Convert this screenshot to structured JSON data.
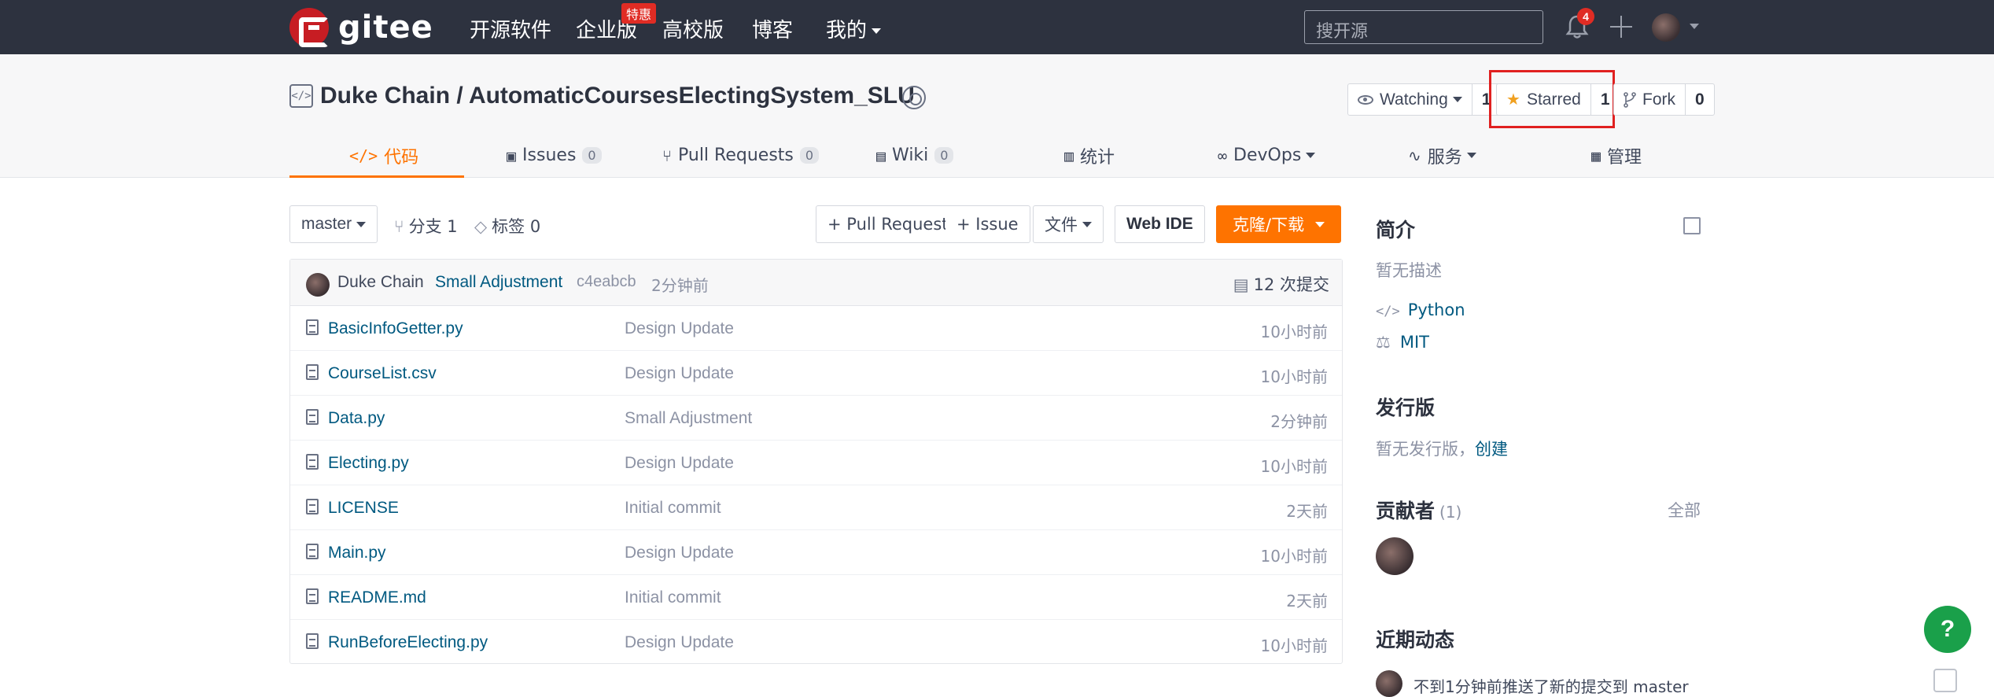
{
  "brand": {
    "name": "gitee"
  },
  "nav": {
    "items": [
      {
        "label": "开源软件"
      },
      {
        "label": "企业版"
      },
      {
        "label": "高校版"
      },
      {
        "label": "博客"
      },
      {
        "label": "我的"
      }
    ],
    "enterprise_badge": "特惠",
    "search_placeholder": "搜开源",
    "notification_count": "4"
  },
  "repo": {
    "owner": "Duke Chain",
    "separator": " / ",
    "name": "AutomaticCoursesElectingSystem_SLU",
    "watch": {
      "label": "Watching",
      "count": "1"
    },
    "star": {
      "label": "Starred",
      "count": "1"
    },
    "fork": {
      "label": "Fork",
      "count": "0"
    }
  },
  "tabs": [
    {
      "label": "代码",
      "active": true
    },
    {
      "label": "Issues",
      "count": "0"
    },
    {
      "label": "Pull Requests",
      "count": "0"
    },
    {
      "label": "Wiki",
      "count": "0"
    },
    {
      "label": "统计"
    },
    {
      "label": "DevOps"
    },
    {
      "label": "服务"
    },
    {
      "label": "管理"
    }
  ],
  "toolbar": {
    "branch": "master",
    "branches_label": "分支 1",
    "tags_label": "标签 0",
    "pull_request": "+ Pull Request",
    "issue": "+ Issue",
    "file": "文件",
    "web_ide": "Web IDE",
    "clone": "克隆/下载"
  },
  "latest_commit": {
    "author": "Duke Chain",
    "message": "Small Adjustment",
    "hash": "c4eabcb",
    "time": "2分钟前",
    "commit_count": "12 次提交"
  },
  "files": [
    {
      "name": "BasicInfoGetter.py",
      "message": "Design Update",
      "time": "10小时前"
    },
    {
      "name": "CourseList.csv",
      "message": "Design Update",
      "time": "10小时前"
    },
    {
      "name": "Data.py",
      "message": "Small Adjustment",
      "time": "2分钟前"
    },
    {
      "name": "Electing.py",
      "message": "Design Update",
      "time": "10小时前"
    },
    {
      "name": "LICENSE",
      "message": "Initial commit",
      "time": "2天前"
    },
    {
      "name": "Main.py",
      "message": "Design Update",
      "time": "10小时前"
    },
    {
      "name": "README.md",
      "message": "Initial commit",
      "time": "2天前"
    },
    {
      "name": "RunBeforeElecting.py",
      "message": "Design Update",
      "time": "10小时前"
    }
  ],
  "sidebar": {
    "intro_title": "简介",
    "intro_desc": "暂无描述",
    "language": "Python",
    "license": "MIT",
    "releases_title": "发行版",
    "releases_text": "暂无发行版，",
    "releases_create": "创建",
    "contributors_title": "贡献者",
    "contributors_count": "(1)",
    "contributors_all": "全部",
    "activity_title": "近期动态",
    "activity_text": "不到1分钟前推送了新的提交到 master"
  },
  "colors": {
    "accent": "#fe7300",
    "topbar": "#2d323f",
    "link": "#005980",
    "highlight": "#e02020"
  }
}
